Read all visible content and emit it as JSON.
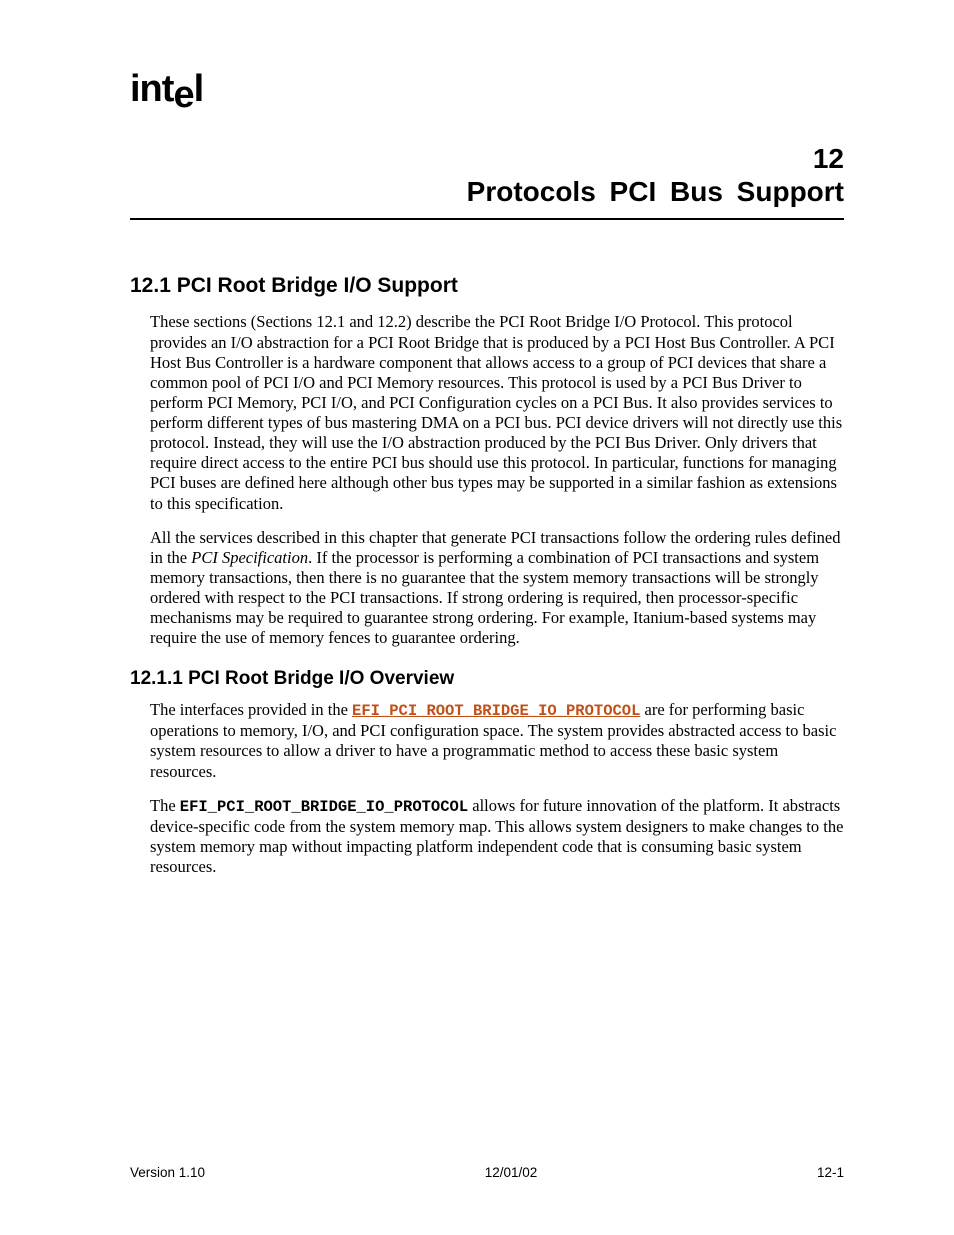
{
  "logo_text": "intel",
  "chapter": {
    "number": "12",
    "title": "Protocols   PCI Bus Support"
  },
  "section1": {
    "heading": "12.1  PCI Root Bridge I/O Support",
    "p1": "These sections (Sections 12.1 and 12.2) describe the PCI Root Bridge I/O Protocol.  This protocol provides an I/O abstraction for a PCI Root Bridge that is produced by a PCI Host Bus Controller.  A PCI Host Bus Controller is a hardware component that allows access to a group of PCI devices that share a common pool of PCI I/O and PCI Memory resources.  This protocol is used by a PCI Bus Driver to perform PCI Memory, PCI I/O, and PCI Configuration cycles on a PCI Bus.  It also provides services to perform different types of bus mastering DMA on a PCI bus.  PCI device drivers will not directly use this protocol.  Instead, they will use the I/O abstraction produced by the PCI Bus Driver.  Only drivers that require direct access to the entire PCI bus should use this protocol.  In particular, functions for managing PCI buses are defined here although other bus types may be supported in a similar fashion as extensions to this specification.",
    "p2_a": "All the services described in this chapter that generate PCI transactions follow the ordering rules defined in the ",
    "p2_italic": "PCI Specification",
    "p2_b": ".  If the processor is performing a combination of PCI transactions and system memory transactions, then there is no guarantee that the system memory transactions will be strongly ordered with respect to the PCI transactions.  If strong ordering is required, then processor-specific mechanisms may be required to guarantee strong ordering.  For example, Itanium-based systems may require the use of memory fences to guarantee ordering."
  },
  "section1_1": {
    "heading": "12.1.1   PCI Root Bridge I/O Overview",
    "p1_a": "The interfaces provided in the ",
    "p1_code": "EFI_PCI_ROOT_BRIDGE_IO_PROTOCOL",
    "p1_b": " are for performing basic operations to memory, I/O, and PCI configuration space.  The system provides abstracted access to basic system resources to allow a driver to have a programmatic method to access these basic system resources.",
    "p2_a": "The ",
    "p2_code": "EFI_PCI_ROOT_BRIDGE_IO_PROTOCOL",
    "p2_b": " allows for future innovation of the platform.  It abstracts device-specific code from the system memory map.  This allows system designers to make changes to the system memory map without impacting platform independent code that is consuming basic system resources."
  },
  "footer": {
    "left": "Version 1.10",
    "center": "12/01/02",
    "right": "12-1"
  }
}
